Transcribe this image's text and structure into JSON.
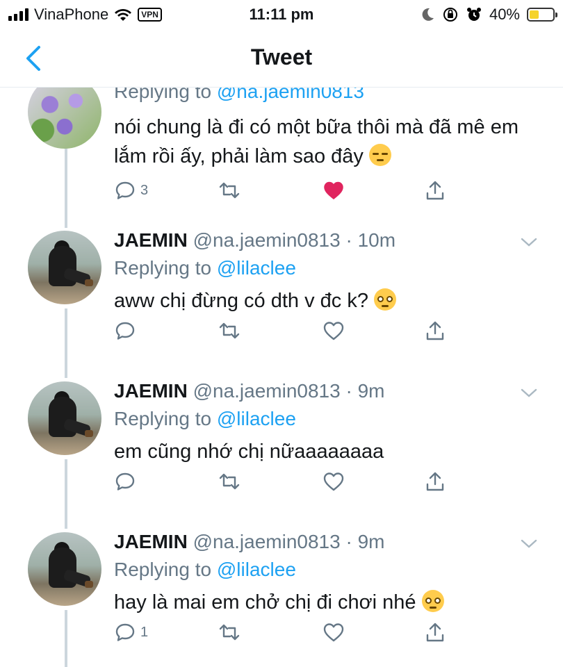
{
  "status_bar": {
    "carrier": "VinaPhone",
    "vpn_label": "VPN",
    "time": "11:11 pm",
    "battery": "40%",
    "battery_level": 0.4,
    "icons": [
      "signal-icon",
      "wifi-icon",
      "moon-icon",
      "orientation-lock-icon",
      "alarm-icon",
      "battery-charging-icon"
    ]
  },
  "nav": {
    "title": "Tweet",
    "back_icon": "chevron-left-icon"
  },
  "tweets": [
    {
      "name": "",
      "handle": "",
      "time": "",
      "replying_prefix": "Replying to ",
      "replying_to": "@na.jaemin0813",
      "body": "nói chung là đi có một bữa thôi mà đã mê em lắm rồi ấy, phải làm sao đây",
      "emoji": "disappointed-face-emoji",
      "reply_count": "3",
      "liked": true,
      "like_color": "#e0245e"
    },
    {
      "name": "JAEMIN",
      "handle": "@na.jaemin0813",
      "time": "10m",
      "replying_prefix": "Replying to ",
      "replying_to": "@lilaclee",
      "body": "aww chị đừng có dth v đc k?",
      "emoji": "pleading-face-emoji",
      "reply_count": "",
      "liked": false
    },
    {
      "name": "JAEMIN",
      "handle": "@na.jaemin0813",
      "time": "9m",
      "replying_prefix": "Replying to ",
      "replying_to": "@lilaclee",
      "body": "em cũng nhớ chị nữaaaaaaaa",
      "emoji": "",
      "reply_count": "",
      "liked": false
    },
    {
      "name": "JAEMIN",
      "handle": "@na.jaemin0813",
      "time": "9m",
      "replying_prefix": "Replying to ",
      "replying_to": "@lilaclee",
      "body": "hay là mai em chở chị đi chơi nhé",
      "emoji": "pleading-face-emoji",
      "reply_count": "1",
      "liked": false
    }
  ],
  "colors": {
    "accent": "#1da1f2",
    "secondary_text": "#657786",
    "thread_line": "#ccd6dd"
  }
}
